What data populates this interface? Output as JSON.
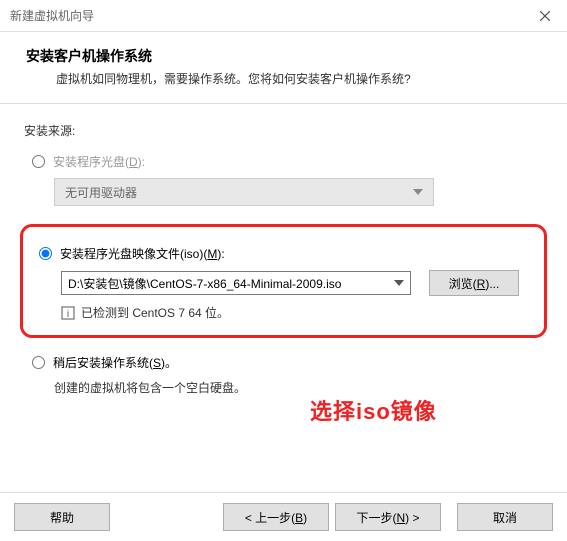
{
  "window": {
    "title": "新建虚拟机向导"
  },
  "header": {
    "title": "安装客户机操作系统",
    "subtitle": "虚拟机如同物理机，需要操作系统。您将如何安装客户机操作系统?"
  },
  "source": {
    "label": "安装来源:",
    "disc": {
      "label_pre": "安装程序光盘(",
      "key": "D",
      "label_post": "):",
      "drive": "无可用驱动器"
    },
    "iso": {
      "label_pre": "安装程序光盘映像文件(iso)(",
      "key": "M",
      "label_post": "):",
      "path": "D:\\安装包\\镜像\\CentOS-7-x86_64-Minimal-2009.iso",
      "browse_pre": "浏览(",
      "browse_key": "R",
      "browse_post": ")...",
      "detected": "已检测到 CentOS 7 64 位。"
    },
    "later": {
      "label_pre": "稍后安装操作系统(",
      "key": "S",
      "label_post": ")。",
      "desc": "创建的虚拟机将包含一个空白硬盘。"
    }
  },
  "annotation": "选择iso镜像",
  "footer": {
    "help": "帮助",
    "prev_pre": "< 上一步(",
    "prev_key": "B",
    "prev_post": ")",
    "next_pre": "下一步(",
    "next_key": "N",
    "next_post": ") >",
    "cancel": "取消"
  }
}
